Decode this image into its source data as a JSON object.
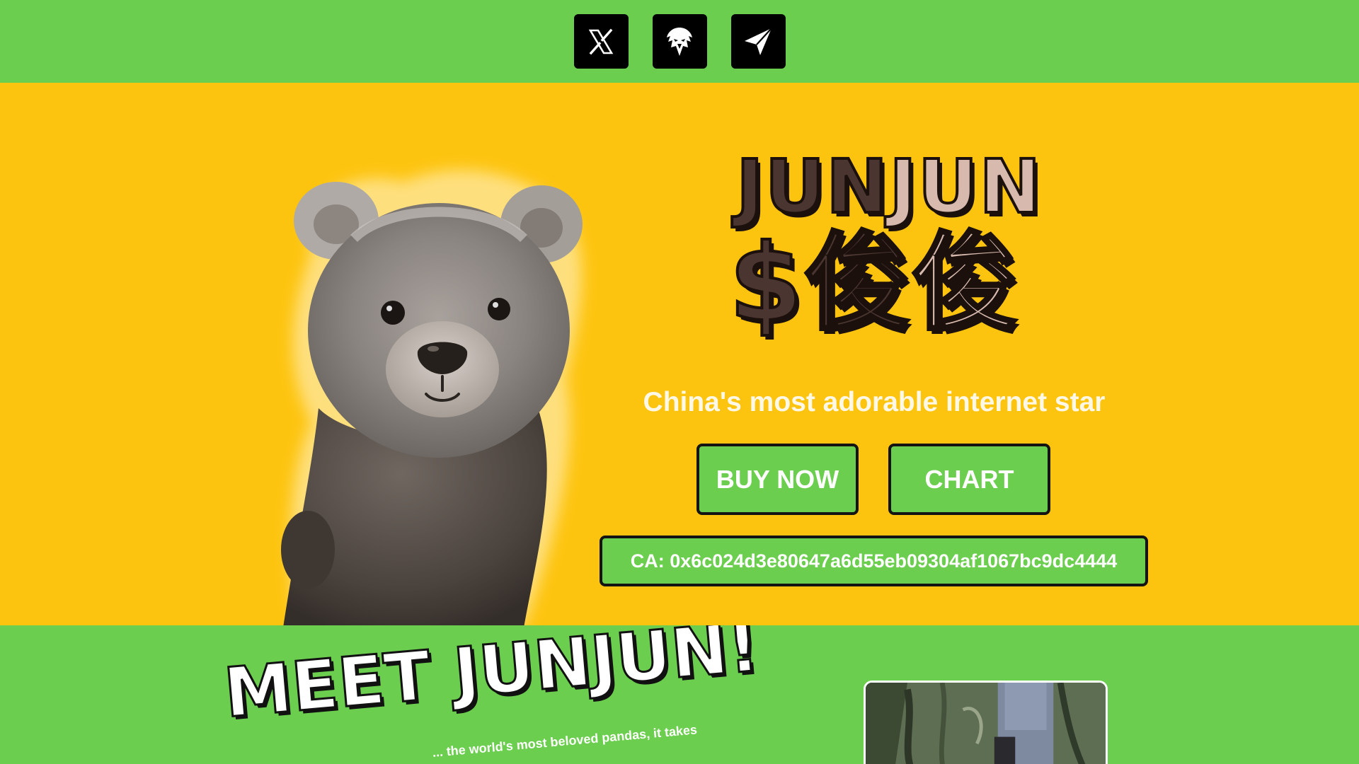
{
  "nav": {
    "social": [
      {
        "name": "x-icon"
      },
      {
        "name": "eagle-icon"
      },
      {
        "name": "telegram-icon"
      }
    ]
  },
  "hero": {
    "logo_line1": "JUNJUN",
    "logo_line2": "$俊俊",
    "tagline": "China's most adorable internet star",
    "buy_label": "BUY NOW",
    "chart_label": "CHART",
    "contract": "CA: 0x6c024d3e80647a6d55eb09304af1067bc9dc4444"
  },
  "meet": {
    "title": "MEET JUNJUN!",
    "body": "... the world's most beloved pandas, it takes"
  },
  "colors": {
    "green": "#6cce4e",
    "yellow": "#fdc40f",
    "logo_brown": "#4a3530",
    "logo_light": "#d7b9ae"
  }
}
